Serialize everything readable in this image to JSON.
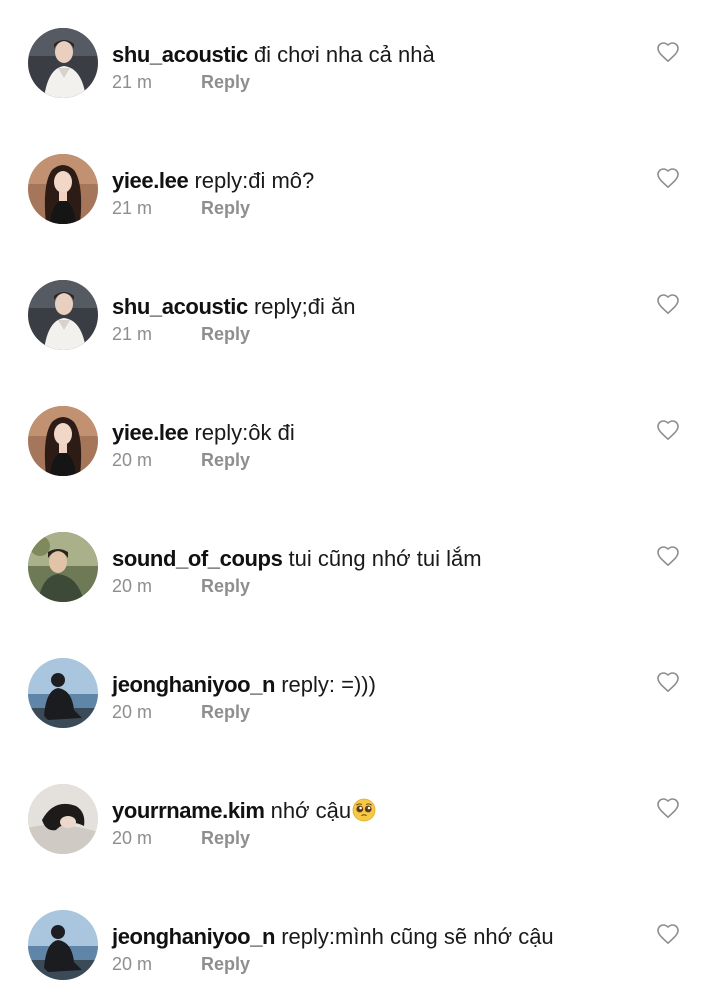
{
  "comments": [
    {
      "username": "shu_acoustic",
      "text": "đi chơi nha cả nhà",
      "time": "21 m",
      "reply_label": "Reply",
      "avatar": "avatar-man-white-shirt"
    },
    {
      "username": "yiee.lee",
      "text": "reply:đi mô?",
      "time": "21 m",
      "reply_label": "Reply",
      "avatar": "avatar-woman-dark-hair"
    },
    {
      "username": "shu_acoustic",
      "text": "reply;đi ăn",
      "time": "21 m",
      "reply_label": "Reply",
      "avatar": "avatar-man-white-shirt"
    },
    {
      "username": "yiee.lee",
      "text": "reply:ôk đi",
      "time": "20 m",
      "reply_label": "Reply",
      "avatar": "avatar-woman-dark-hair"
    },
    {
      "username": "sound_of_coups",
      "text": "tui cũng nhớ tui lắm",
      "time": "20 m",
      "reply_label": "Reply",
      "avatar": "avatar-man-outdoor"
    },
    {
      "username": "jeonghaniyoo_n",
      "text": "reply: =)))",
      "time": "20 m",
      "reply_label": "Reply",
      "avatar": "avatar-person-seaside"
    },
    {
      "username": "yourrname.kim",
      "text": "nhớ cậu",
      "time": "20 m",
      "reply_label": "Reply",
      "avatar": "avatar-person-lying",
      "emoji": "pleading-face-emoji"
    },
    {
      "username": "jeonghaniyoo_n",
      "text": "reply:mình cũng sẽ nhớ cậu",
      "time": "20 m",
      "reply_label": "Reply",
      "avatar": "avatar-person-seaside"
    }
  ],
  "icons": {
    "like": "heart-outline-icon"
  },
  "colors": {
    "text": "#111111",
    "meta": "#8e8e8e",
    "icon": "#8e8e8e",
    "background": "#ffffff"
  }
}
